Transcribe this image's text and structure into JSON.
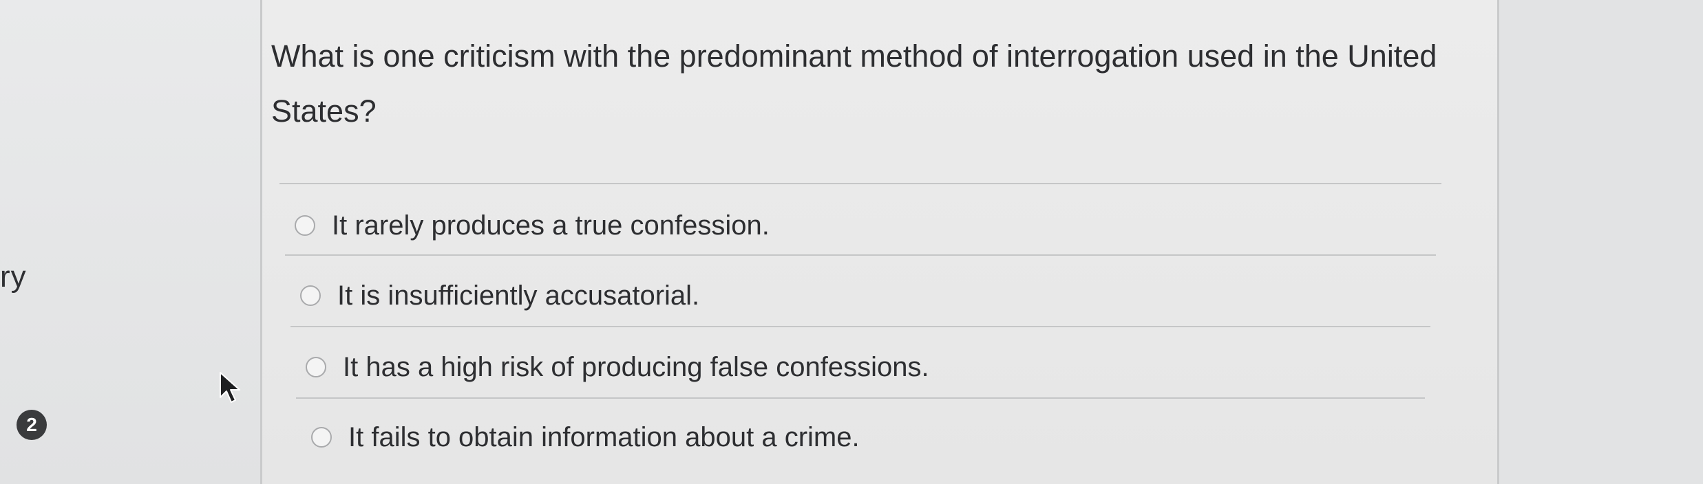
{
  "sidebar": {
    "fragment_text": "ry",
    "question_number": "2"
  },
  "question": {
    "text": "What is one criticism with the predominant method of interrogation used in the United States?",
    "options": [
      {
        "label": "It rarely produces a true confession.",
        "selected": false
      },
      {
        "label": "It is insufficiently accusatorial.",
        "selected": false
      },
      {
        "label": "It has a high risk of producing false confessions.",
        "selected": false
      },
      {
        "label": "It fails to obtain information about a crime.",
        "selected": false
      }
    ]
  },
  "icons": {
    "cursor": "mouse-pointer-icon",
    "option": "radio-button-icon"
  },
  "colors": {
    "background": "#e4e5e6",
    "card": "#ececec",
    "text": "#2d2e31",
    "badge": "#3a3b3d",
    "divider": "#c5c6c7"
  }
}
